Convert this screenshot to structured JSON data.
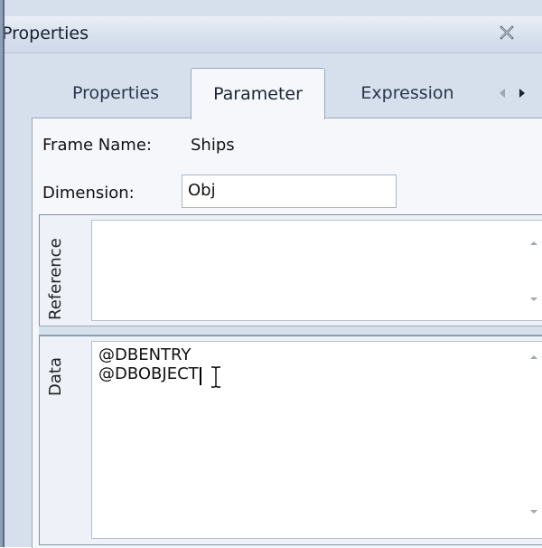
{
  "window": {
    "title": "Properties",
    "close_icon": "close-icon"
  },
  "tabs": [
    {
      "label": "Properties",
      "active": false
    },
    {
      "label": "Parameter",
      "active": true
    },
    {
      "label": "Expression",
      "active": false
    }
  ],
  "tab_nav": {
    "prev_icon": "chevron-left-icon",
    "next_icon": "chevron-right-icon"
  },
  "fields": {
    "frame_name_label": "Frame Name:",
    "frame_name_value": "Ships",
    "dimension_label": "Dimension:",
    "dimension_value": "Obj"
  },
  "reference": {
    "label": "Reference",
    "content": ""
  },
  "data": {
    "label": "Data",
    "lines": [
      "@DBENTRY",
      "@DBOBJECT"
    ]
  },
  "colors": {
    "frame_bg": "#d6e0ec",
    "panel_bg": "#f5f7fb",
    "border": "#9aaabf"
  }
}
